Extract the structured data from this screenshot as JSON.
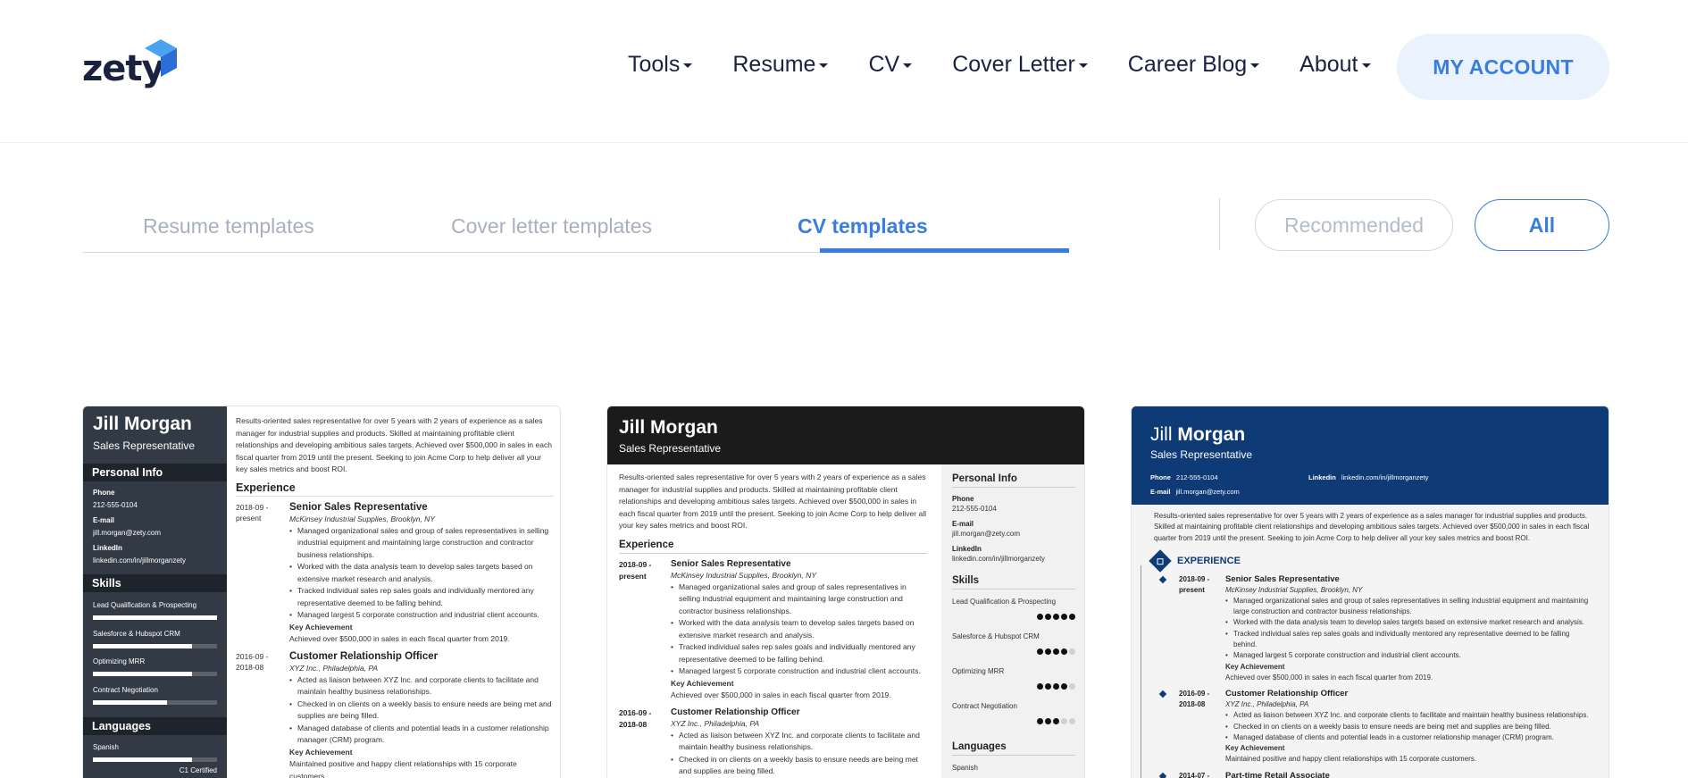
{
  "header": {
    "logo_text": "zety",
    "nav": [
      {
        "label": "Tools"
      },
      {
        "label": "Resume"
      },
      {
        "label": "CV"
      },
      {
        "label": "Cover Letter"
      },
      {
        "label": "Career Blog"
      },
      {
        "label": "About"
      }
    ],
    "account_label": "MY ACCOUNT",
    "accent_color": "#3b7ddd"
  },
  "tabs": [
    {
      "label": "Resume templates",
      "active": false
    },
    {
      "label": "Cover letter templates",
      "active": false
    },
    {
      "label": "CV templates",
      "active": true
    }
  ],
  "filters": {
    "recommended": "Recommended",
    "all": "All"
  },
  "resume": {
    "name": "Jill Morgan",
    "first": "Jill",
    "last": "Morgan",
    "role": "Sales Representative",
    "phone_label": "Phone",
    "phone": "212-555-0104",
    "email_label": "E-mail",
    "email": "jill.morgan@zety.com",
    "linkedin_label": "LinkedIn",
    "linkedin_label_caps": "Linkedin",
    "linkedin": "linkedin.com/in/jillmorganzety",
    "personal_info": "Personal Info",
    "skills_title": "Skills",
    "languages_title": "Languages",
    "experience_title": "Experience",
    "experience_title_caps": "EXPERIENCE",
    "summary": "Results-oriented sales representative for over 5 years with 2 years of experience as a sales manager for industrial supplies and products. Skilled at maintaining profitable client relationships and developing ambitious sales targets. Achieved over $500,000 in sales in each fiscal quarter from 2019 until the present. Seeking to join Acme Corp to help deliver all your key sales metrics and boost ROI.",
    "skills": [
      {
        "name": "Lead Qualification & Prospecting",
        "level": 1.0,
        "dots": 5
      },
      {
        "name": "Salesforce & Hubspot CRM",
        "level": 0.8,
        "dots": 4
      },
      {
        "name": "Optimizing MRR",
        "level": 0.8,
        "dots": 4
      },
      {
        "name": "Contract Negotiation",
        "level": 0.6,
        "dots": 3
      }
    ],
    "language": {
      "name": "Spanish",
      "level_text": "C1 Certified",
      "level": 0.8,
      "dots": 4
    },
    "jobs": [
      {
        "date1": "2018-09 -",
        "date2": "present",
        "title": "Senior Sales Representative",
        "company": "McKinsey Industrial Supplies, Brooklyn, NY",
        "bullets": [
          "Managed organizational sales and group of sales representatives in selling industrial equipment and maintaining large construction and contractor business relationships.",
          "Worked with the data analysis team to develop sales targets based on extensive market research and analysis.",
          "Tracked individual sales rep sales goals and individually mentored any representative deemed to be falling behind.",
          "Managed largest 5 corporate construction and industrial client accounts."
        ],
        "ka_label": "Key Achievement",
        "ka": "Achieved over $500,000 in sales in each fiscal quarter from 2019."
      },
      {
        "date1": "2016-09 -",
        "date2": "2018-08",
        "title": "Customer Relationship Officer",
        "company": "XYZ Inc., Philadelphia, PA",
        "bullets": [
          "Acted as liaison between XYZ Inc. and corporate clients to facilitate and maintain healthy business relationships.",
          "Checked in on clients on a weekly basis to ensure needs are being met and supplies are being filled.",
          "Managed database of clients and potential leads in a customer relationship manager (CRM) program."
        ],
        "ka_label": "Key Achievement",
        "ka": "Maintained positive and happy client relationships with 15 corporate customers."
      },
      {
        "date1": "2014-07 -",
        "title": "Part-time Retail Associate"
      }
    ]
  }
}
